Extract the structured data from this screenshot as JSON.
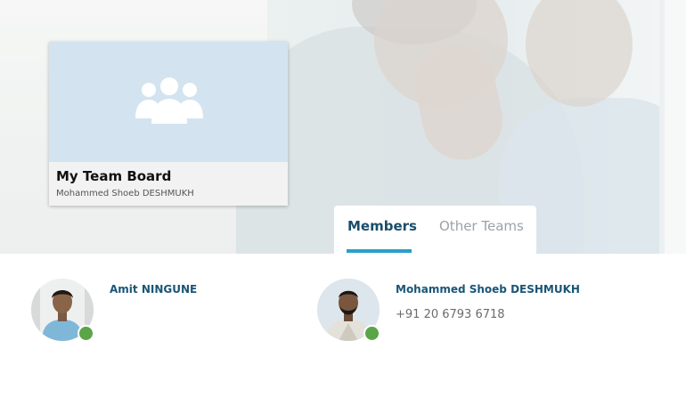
{
  "board": {
    "title": "My Team Board",
    "owner": "Mohammed Shoeb DESHMUKH"
  },
  "tabs": [
    {
      "label": "Members",
      "active": true
    },
    {
      "label": "Other Teams",
      "active": false
    }
  ],
  "members": [
    {
      "name": "Amit NINGUNE",
      "phone": "",
      "status": "online"
    },
    {
      "name": "Mohammed Shoeb DESHMUKH",
      "phone": "+91 20 6793 6718",
      "status": "online"
    }
  ],
  "colors": {
    "accent": "#2a9fc9",
    "active_tab_text": "#1a4d6a",
    "member_name": "#1a5577",
    "online": "#5aa547",
    "board_thumb": "#d3e4f0"
  },
  "icons": {
    "board_thumbnail": "team-group-icon"
  }
}
